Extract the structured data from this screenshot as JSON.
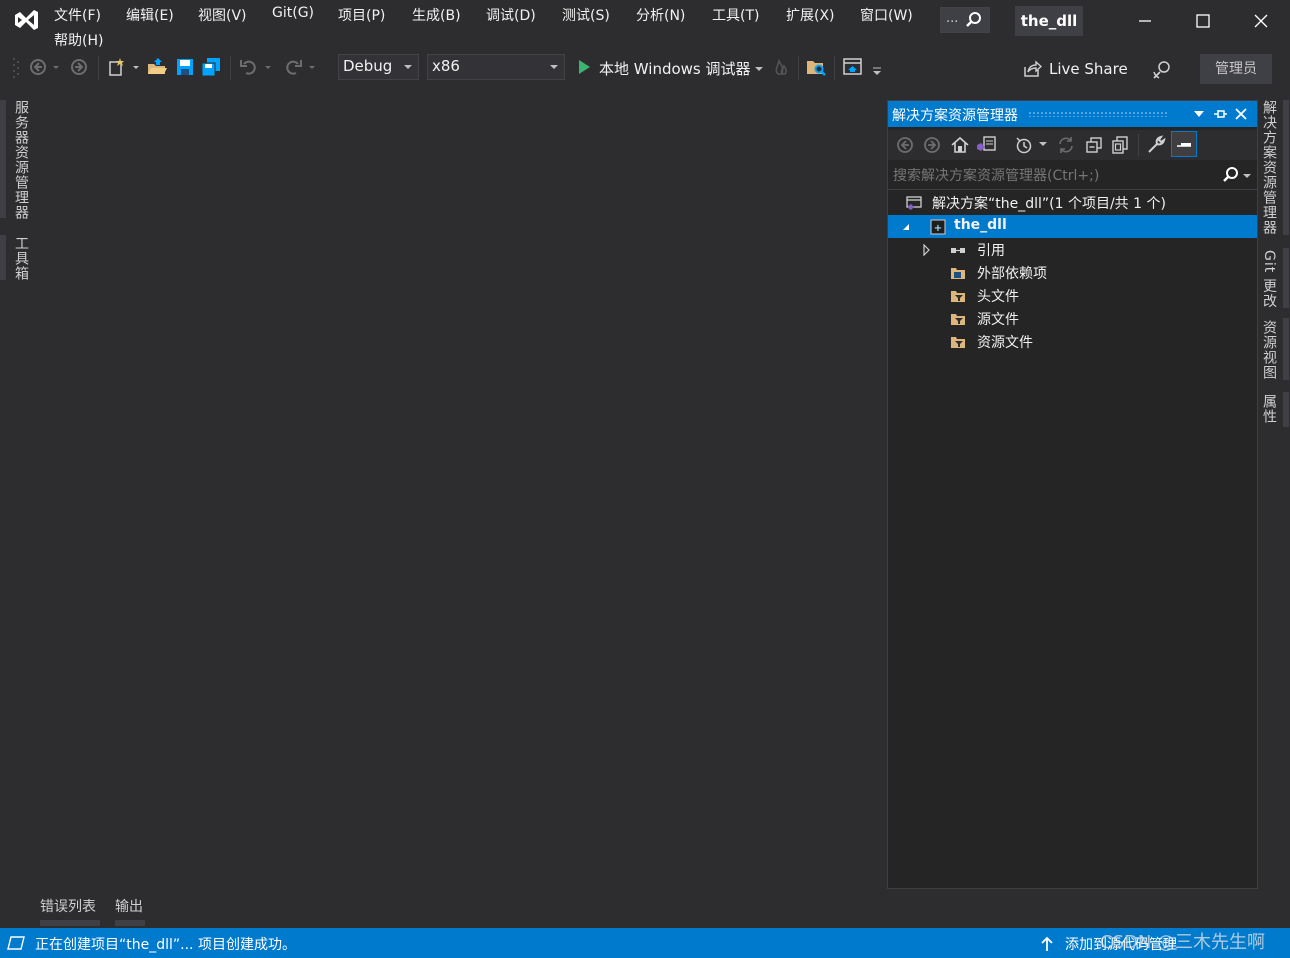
{
  "menu": {
    "items": [
      "文件(F)",
      "编辑(E)",
      "视图(V)",
      "Git(G)",
      "项目(P)",
      "生成(B)",
      "调试(D)",
      "测试(S)",
      "分析(N)",
      "工具(T)",
      "扩展(X)",
      "窗口(W)"
    ],
    "help": "帮助(H)",
    "search_dots": "..."
  },
  "title": "the_dll",
  "toolbar": {
    "config": "Debug",
    "platform": "x86",
    "run_label": "本地 Windows 调试器",
    "live_share": "Live Share",
    "admin": "管理员"
  },
  "left_tabs": [
    "服务器资源管理器",
    "工具箱"
  ],
  "solution_explorer": {
    "title": "解决方案资源管理器",
    "search_placeholder": "搜索解决方案资源管理器(Ctrl+;)",
    "tree": [
      {
        "label": "解决方案“the_dll”(1 个项目/共 1 个)"
      },
      {
        "label": "the_dll"
      },
      {
        "label": "引用"
      },
      {
        "label": "外部依赖项"
      },
      {
        "label": "头文件"
      },
      {
        "label": "源文件"
      },
      {
        "label": "资源文件"
      }
    ]
  },
  "right_tabs": [
    "解决方案资源管理器",
    "Git 更改",
    "资源视图",
    "属性"
  ],
  "bottom_tabs": [
    "错误列表",
    "输出"
  ],
  "status": {
    "message": "正在创建项目“the_dll”... 项目创建成功。",
    "source_control": "添加到源代码管理",
    "watermark": "CSDN @三木先生啊"
  },
  "colors": {
    "accent": "#007acc",
    "background": "#2d2d30",
    "panel": "#252526",
    "run_green": "#3cb371",
    "vs_purple": "#865fc5"
  }
}
